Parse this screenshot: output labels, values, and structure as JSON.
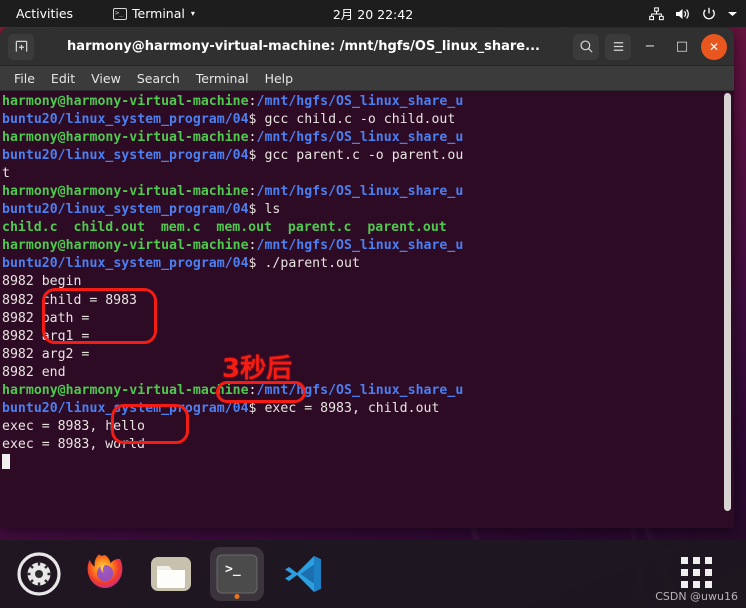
{
  "topbar": {
    "activities": "Activities",
    "app_name": "Terminal",
    "app_icon": "terminal-icon",
    "caret": "▾",
    "clock": "2月 20  22:42",
    "indicators": [
      "network-icon",
      "volume-icon",
      "power-icon",
      "chevron-down-icon"
    ]
  },
  "window": {
    "title": "harmony@harmony-virtual-machine: /mnt/hgfs/OS_linux_share...",
    "new_tab_icon": "new-tab-icon",
    "search_icon": "search-icon",
    "hamburger_icon": "hamburger-menu-icon",
    "minimize": "−",
    "maximize": "□",
    "close": "✕"
  },
  "menubar": {
    "items": [
      "File",
      "Edit",
      "View",
      "Search",
      "Terminal",
      "Help"
    ]
  },
  "terminal": {
    "prompt_user": "harmony@harmony-virtual-machine",
    "prompt_path": "/mnt/hgfs/OS_linux_share_ubuntu20/linux_system_program/04",
    "lines": [
      {
        "type": "prompt",
        "cmd": " gcc child.c -o child.out"
      },
      {
        "type": "prompt",
        "cmd": " gcc parent.c -o parent.out"
      },
      {
        "type": "prompt",
        "cmd": " ls"
      },
      {
        "type": "ls",
        "files": [
          "child.c",
          "child.out",
          "mem.c",
          "mem.out",
          "parent.c",
          "parent.out"
        ]
      },
      {
        "type": "prompt",
        "cmd": " ./parent.out"
      },
      {
        "type": "out",
        "text": "8982 begin"
      },
      {
        "type": "out",
        "text": "8982 child = 8983"
      },
      {
        "type": "out",
        "text": "8982 path ="
      },
      {
        "type": "out",
        "text": "8982 arg1 ="
      },
      {
        "type": "out",
        "text": "8982 arg2 ="
      },
      {
        "type": "out",
        "text": "8982 end"
      },
      {
        "type": "prompt",
        "cmd": " exec = 8983, child.out"
      },
      {
        "type": "out",
        "text": "exec = 8983, hello"
      },
      {
        "type": "out",
        "text": "exec = 8983, world"
      }
    ],
    "cursor": "block-cursor"
  },
  "annotations": {
    "label_3s": "3秒后",
    "boxes": [
      "args-box",
      "child-out-box",
      "hello-world-box"
    ],
    "color": "#f41c13"
  },
  "dock": {
    "items": [
      {
        "name": "settings",
        "icon": "gear-icon",
        "active": false
      },
      {
        "name": "firefox",
        "icon": "firefox-icon",
        "active": false
      },
      {
        "name": "files",
        "icon": "folder-icon",
        "active": false
      },
      {
        "name": "terminal",
        "icon": "terminal-icon",
        "active": true
      },
      {
        "name": "vscode",
        "icon": "vscode-icon",
        "active": false
      }
    ],
    "show_apps_icon": "apps-grid-icon",
    "watermark": "CSDN @uwu16"
  }
}
